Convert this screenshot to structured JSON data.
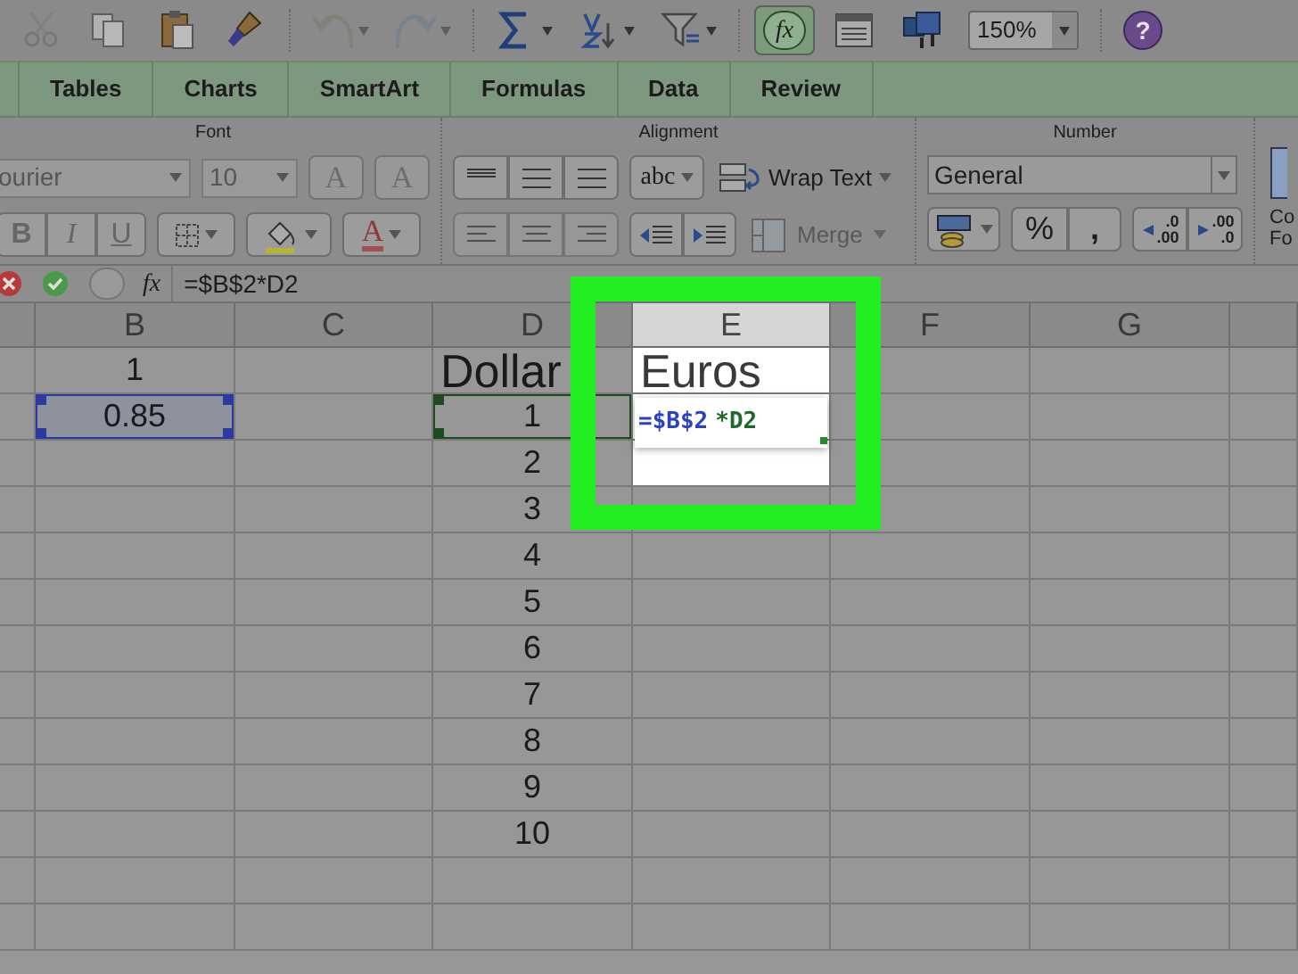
{
  "toolbar": {
    "items": [
      {
        "kind": "cut",
        "disabled": true
      },
      {
        "kind": "copy",
        "disabled": true
      },
      {
        "kind": "paste",
        "disabled": false
      },
      {
        "kind": "format-painter",
        "disabled": false
      },
      {
        "kind": "undo",
        "disabled": true
      },
      {
        "kind": "redo",
        "disabled": true
      },
      {
        "kind": "autosum",
        "disabled": false
      },
      {
        "kind": "sort",
        "disabled": false
      },
      {
        "kind": "filter",
        "disabled": false
      },
      {
        "kind": "function",
        "disabled": false,
        "pressed": true,
        "label": "fx"
      },
      {
        "kind": "form",
        "disabled": false
      },
      {
        "kind": "media",
        "disabled": false
      }
    ],
    "zoom": "150%",
    "help": "?"
  },
  "tabs": [
    {
      "label": "Tables",
      "selected": false
    },
    {
      "label": "Charts",
      "selected": false
    },
    {
      "label": "SmartArt",
      "selected": false
    },
    {
      "label": "Formulas",
      "selected": false
    },
    {
      "label": "Data",
      "selected": false
    },
    {
      "label": "Review",
      "selected": false
    }
  ],
  "ribbon": {
    "font": {
      "title": "Font",
      "font_name": "ourier",
      "font_size": "10",
      "bold": "B",
      "italic": "I",
      "underline": "U",
      "grow": "A",
      "shrink": "A",
      "font_color": "A"
    },
    "alignment": {
      "title": "Alignment",
      "orientation": "abc",
      "wrap": "Wrap Text",
      "merge": "Merge"
    },
    "number": {
      "title": "Number",
      "format": "General",
      "percent": "%",
      "comma": ",",
      "increase_decimals": [
        ".0",
        ".00"
      ],
      "decrease_decimals": [
        ".00",
        ".0"
      ]
    },
    "cut_group": [
      "Co",
      "Fo"
    ]
  },
  "formula_bar": {
    "fx": "fx",
    "formula": "=$B$2*D2"
  },
  "sheet": {
    "columns": [
      {},
      {
        "label": "B"
      },
      {
        "label": "C"
      },
      {
        "label": "D"
      },
      {
        "label": "E",
        "spotlit": true
      },
      {
        "label": "F"
      },
      {
        "label": "G"
      },
      {}
    ],
    "rows": [
      {
        "cells": [
          {},
          {
            "text": "1"
          },
          {},
          {
            "text": "Dollar",
            "kind": "heading"
          },
          {
            "text": "Euros",
            "kind": "heading",
            "spotlit": true
          },
          {},
          {},
          {}
        ]
      },
      {
        "cells": [
          {},
          {
            "text": "0.85",
            "selected": true
          },
          {},
          {
            "text": "1",
            "referenced": true
          },
          {
            "editing": true,
            "spotlit": true,
            "formula": [
              {
                "text": "=$B$2",
                "color": "#2b40c4"
              },
              {
                "text": "*D2",
                "color": "#1d6a2c"
              }
            ]
          },
          {},
          {},
          {}
        ]
      },
      {
        "cells": [
          {},
          {},
          {},
          {
            "text": "2"
          },
          {
            "spotlit": true
          },
          {},
          {},
          {}
        ]
      },
      {
        "cells": [
          {},
          {},
          {},
          {
            "text": "3"
          },
          {},
          {},
          {},
          {}
        ]
      },
      {
        "cells": [
          {},
          {},
          {},
          {
            "text": "4"
          },
          {},
          {},
          {},
          {}
        ]
      },
      {
        "cells": [
          {},
          {},
          {},
          {
            "text": "5"
          },
          {},
          {},
          {},
          {}
        ]
      },
      {
        "cells": [
          {},
          {},
          {},
          {
            "text": "6"
          },
          {},
          {},
          {},
          {}
        ]
      },
      {
        "cells": [
          {},
          {},
          {},
          {
            "text": "7"
          },
          {},
          {},
          {},
          {}
        ]
      },
      {
        "cells": [
          {},
          {},
          {},
          {
            "text": "8"
          },
          {},
          {},
          {},
          {}
        ]
      },
      {
        "cells": [
          {},
          {},
          {},
          {
            "text": "9"
          },
          {},
          {},
          {},
          {}
        ]
      },
      {
        "cells": [
          {},
          {},
          {},
          {
            "text": "10"
          },
          {},
          {},
          {},
          {}
        ]
      }
    ]
  }
}
